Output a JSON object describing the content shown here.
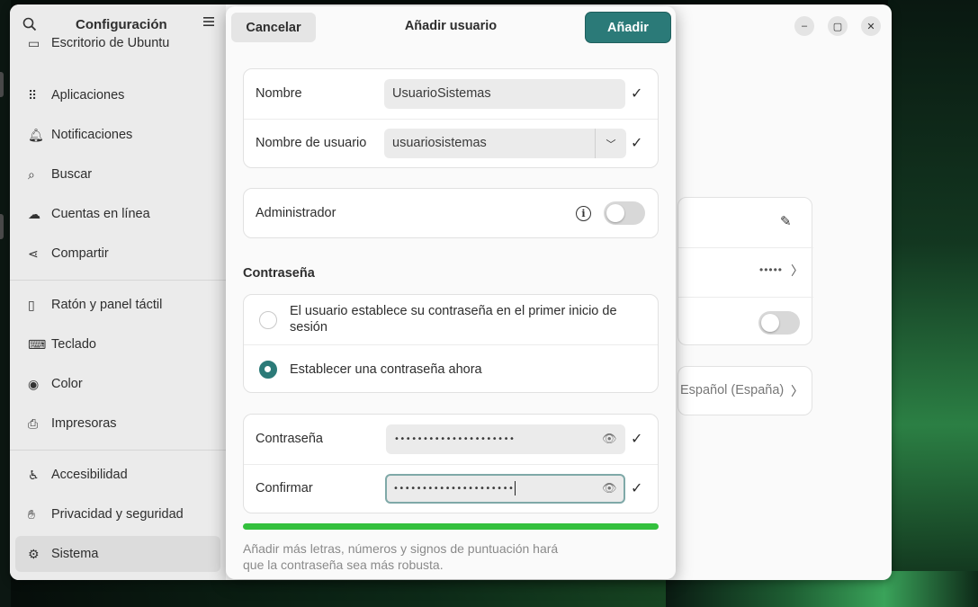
{
  "settings": {
    "title": "Configuración",
    "sidebar_items": [
      {
        "label": "Escritorio de Ubuntu",
        "icon": "desktop-icon"
      },
      {
        "label": "Aplicaciones",
        "icon": "apps-grid-icon"
      },
      {
        "label": "Notificaciones",
        "icon": "bell-icon"
      },
      {
        "label": "Buscar",
        "icon": "search-icon"
      },
      {
        "label": "Cuentas en línea",
        "icon": "cloud-icon"
      },
      {
        "label": "Compartir",
        "icon": "share-icon"
      },
      {
        "label": "Ratón y panel táctil",
        "icon": "mouse-icon"
      },
      {
        "label": "Teclado",
        "icon": "keyboard-icon"
      },
      {
        "label": "Color",
        "icon": "color-icon"
      },
      {
        "label": "Impresoras",
        "icon": "printer-icon"
      },
      {
        "label": "Accesibilidad",
        "icon": "accessibility-icon"
      },
      {
        "label": "Privacidad y seguridad",
        "icon": "hand-icon"
      },
      {
        "label": "Sistema",
        "icon": "gear-icon"
      }
    ],
    "background_panel": {
      "password_dots": "•••••",
      "language_value": "Español (España)"
    }
  },
  "dialog": {
    "cancel_label": "Cancelar",
    "title": "Añadir usuario",
    "add_label": "Añadir",
    "name_label": "Nombre",
    "name_value": "UsuarioSistemas",
    "username_label": "Nombre de usuario",
    "username_value": "usuariosistemas",
    "admin_label": "Administrador",
    "admin_enabled": false,
    "password_section": "Contraseña",
    "option_first_login": "El usuario establece su contraseña en el primer inicio de sesión",
    "option_set_now": "Establecer una contraseña ahora",
    "selected_option": "set_now",
    "password_label": "Contraseña",
    "password_value": "•••••••••••••••••••••",
    "confirm_label": "Confirmar",
    "confirm_value": "•••••••••••••••••••••",
    "strength_level": 1.0,
    "hint": "Añadir más letras, números y signos de puntuación hará que la contraseña sea más robusta."
  },
  "colors": {
    "accent": "#2b7a78",
    "strength_bar": "#33c03d"
  }
}
